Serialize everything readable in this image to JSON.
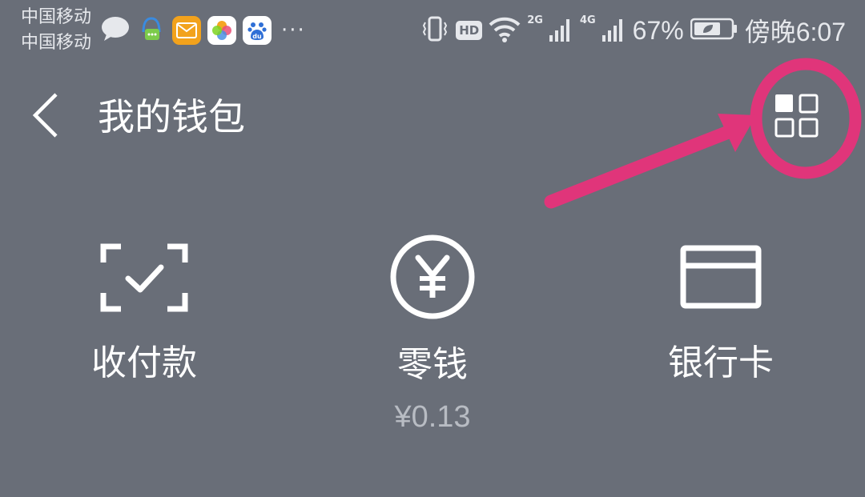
{
  "status_bar": {
    "carrier_1": "中国移动",
    "carrier_2": "中国移动",
    "app_icons": [
      "chat-bubble-icon",
      "qq-icon",
      "mail-icon",
      "gallery-icon",
      "baidu-icon"
    ],
    "more": "···",
    "hd": "HD",
    "net_1": "2G",
    "net_2": "4G",
    "battery": "67%",
    "time": "傍晚6:07"
  },
  "header": {
    "title": "我的钱包"
  },
  "features": [
    {
      "label": "收付款",
      "icon": "scan-check-icon"
    },
    {
      "label": "零钱",
      "icon": "yuan-coin-icon",
      "balance": "¥0.13"
    },
    {
      "label": "银行卡",
      "icon": "bank-card-icon"
    }
  ],
  "colors": {
    "background": "#696e78",
    "annotation": "#e0357a",
    "text": "#ffffff",
    "muted": "#b8bcc3"
  }
}
